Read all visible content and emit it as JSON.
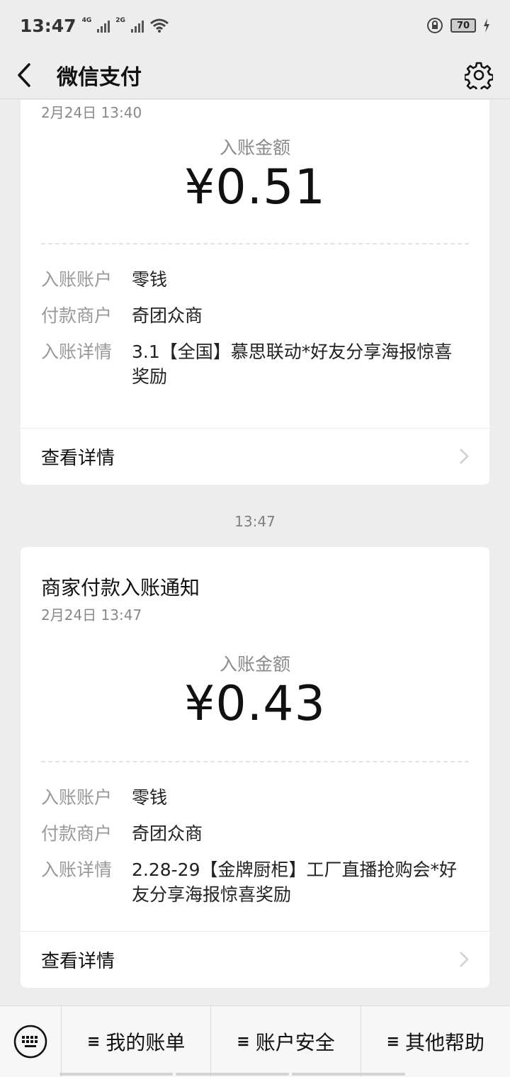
{
  "status_bar": {
    "time": "13:47",
    "net1": "4G",
    "net2": "2G",
    "battery": "70"
  },
  "header": {
    "title": "微信支付"
  },
  "messages": [
    {
      "title": "",
      "date": "2月24日  13:40",
      "amount_label": "入账金额",
      "amount": "¥0.51",
      "rows": [
        {
          "key": "入账账户",
          "value": "零钱"
        },
        {
          "key": "付款商户",
          "value": "奇团众商"
        },
        {
          "key": "入账详情",
          "value": "3.1【全国】慕思联动*好友分享海报惊喜奖励"
        }
      ],
      "detail_link": "查看详情"
    },
    {
      "timestamp": "13:47",
      "title": "商家付款入账通知",
      "date": "2月24日  13:47",
      "amount_label": "入账金额",
      "amount": "¥0.43",
      "rows": [
        {
          "key": "入账账户",
          "value": "零钱"
        },
        {
          "key": "付款商户",
          "value": "奇团众商"
        },
        {
          "key": "入账详情",
          "value": "2.28-29【金牌厨柜】工厂直播抢购会*好友分享海报惊喜奖励"
        }
      ],
      "detail_link": "查看详情"
    }
  ],
  "bottom_menu": {
    "keyboard_icon": "keyboard-icon",
    "items": [
      {
        "icon": "≡",
        "label": "我的账单"
      },
      {
        "icon": "≡",
        "label": "账户安全"
      },
      {
        "icon": "≡",
        "label": "其他帮助"
      }
    ]
  }
}
